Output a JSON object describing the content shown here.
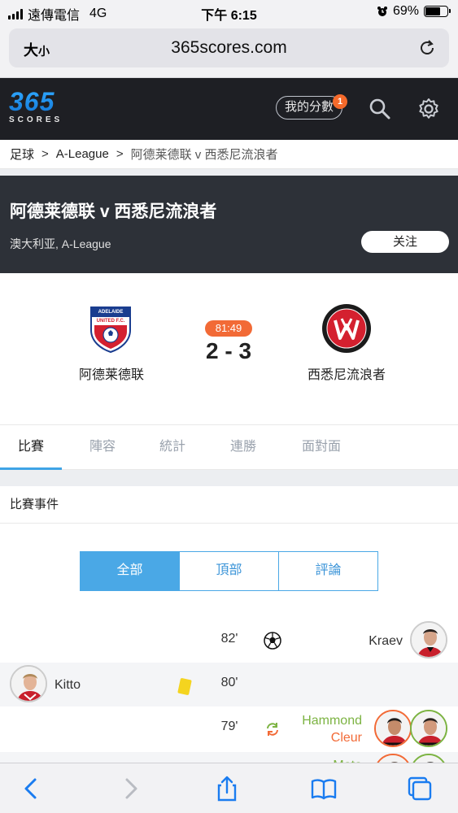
{
  "status_bar": {
    "carrier": "遠傳電信",
    "network": "4G",
    "time": "下午 6:15",
    "battery_pct": "69%",
    "battery_level": 0.69
  },
  "browser": {
    "text_size_label": "大",
    "text_size_small": "小",
    "url": "365scores.com"
  },
  "site_header": {
    "logo_number": "365",
    "logo_word": "SCORES",
    "my_scores_label": "我的分數",
    "my_scores_badge": "1",
    "icons": [
      "search-icon",
      "gear-icon"
    ],
    "accent_color": "#1e8fe8"
  },
  "breadcrumb": {
    "items": [
      "足球",
      "A-League",
      "阿德莱德联 v 西悉尼流浪者"
    ],
    "separator": ">"
  },
  "game": {
    "title": "阿德莱德联 v 西悉尼流浪者",
    "subtitle": "澳大利亚, A-League",
    "follow_label": "关注",
    "home_team": "阿德莱德联",
    "away_team": "西悉尼流浪者",
    "live_minute": "81:49",
    "score": "2 - 3",
    "live_color": "#f26a36"
  },
  "tabs": [
    {
      "label": "比賽",
      "active": true
    },
    {
      "label": "陣容",
      "active": false
    },
    {
      "label": "統計",
      "active": false
    },
    {
      "label": "連勝",
      "active": false
    },
    {
      "label": "面對面",
      "active": false
    }
  ],
  "events": {
    "header": "比賽事件",
    "filters": [
      {
        "label": "全部",
        "active": true
      },
      {
        "label": "頂部",
        "active": false
      },
      {
        "label": "評論",
        "active": false
      }
    ],
    "rows": [
      {
        "minute": "82'",
        "type": "goal",
        "side": "away",
        "player": "Kraev"
      },
      {
        "minute": "80'",
        "type": "yellow-card",
        "side": "home",
        "player": "Kitto"
      },
      {
        "minute": "79'",
        "type": "substitution",
        "side": "away",
        "player_in": "Hammond",
        "player_out": "Cleur"
      },
      {
        "minute": "",
        "type": "substitution",
        "side": "away",
        "player_in": "Mata",
        "player_out": ""
      }
    ]
  },
  "toolbar_icons": [
    "back-icon",
    "forward-icon",
    "share-icon",
    "bookmarks-icon",
    "tabs-icon"
  ]
}
